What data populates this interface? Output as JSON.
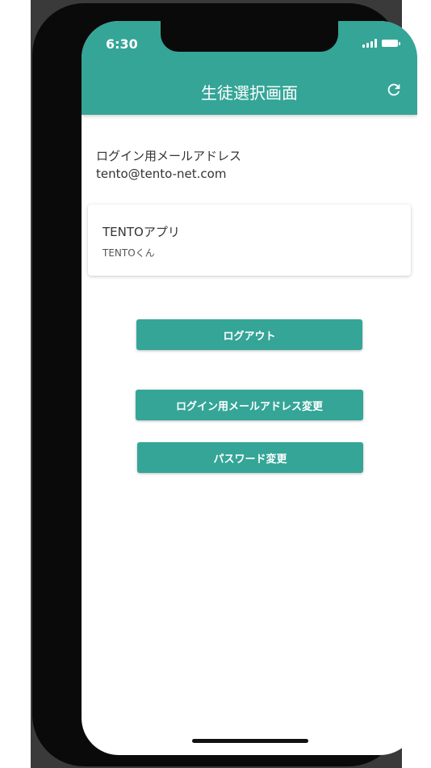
{
  "status_bar": {
    "time": "6:30"
  },
  "header": {
    "title": "生徒選択画面"
  },
  "account": {
    "email_label": "ログイン用メールアドレス",
    "email": "tento@tento-net.com"
  },
  "student_card": {
    "app_name": "TENTOアプリ",
    "student_name": "TENTOくん"
  },
  "buttons": {
    "logout": "ログアウト",
    "change_email": "ログイン用メールアドレス変更",
    "change_password": "パスワード変更"
  },
  "colors": {
    "accent": "#35a597",
    "frame": "#0a0a0a",
    "text": "#333333"
  },
  "icons": {
    "refresh": "refresh-icon",
    "signal": "signal-icon",
    "battery": "battery-icon"
  }
}
